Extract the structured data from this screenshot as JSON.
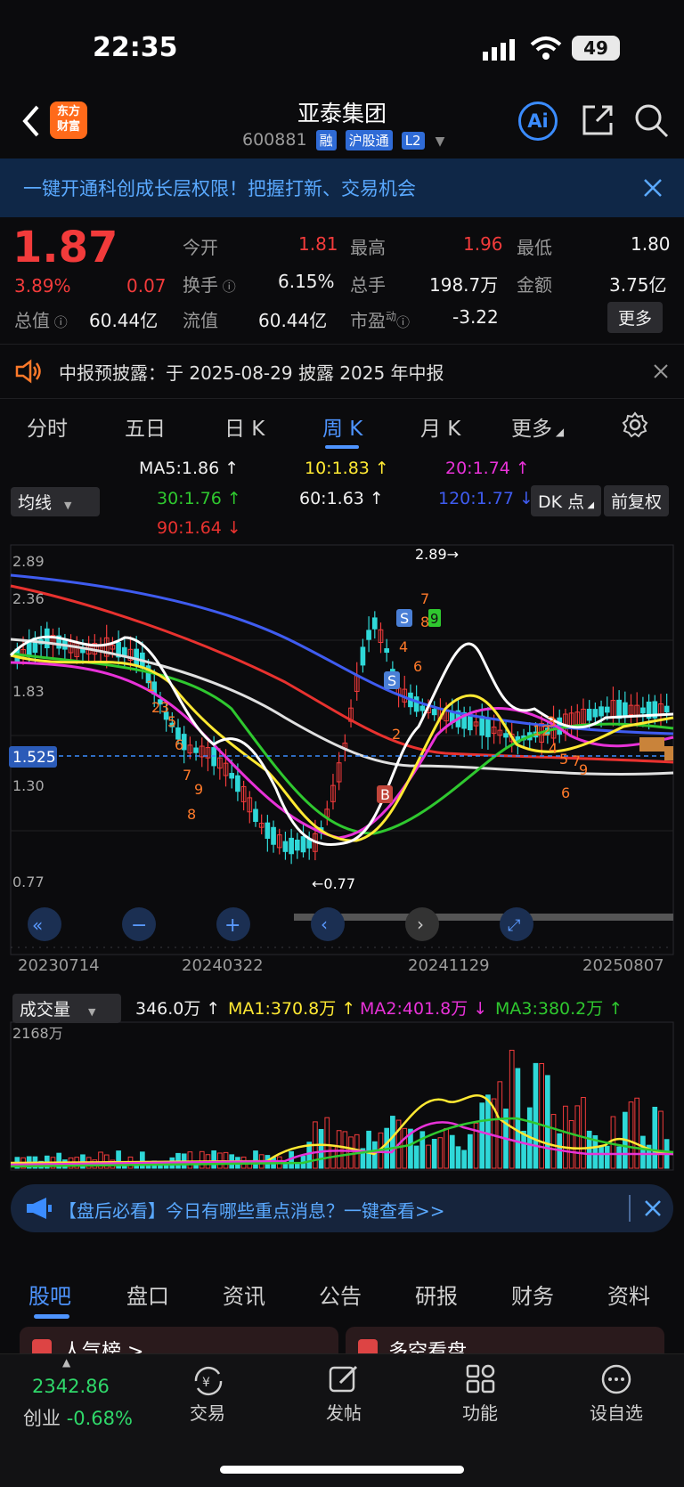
{
  "status": {
    "time": "22:35",
    "battery": "49"
  },
  "nav": {
    "back_icon": "chevron-left-icon",
    "logo_line1": "东方",
    "logo_line2": "财富",
    "title": "亚泰集团",
    "code": "600881",
    "tag1": "融",
    "tag2": "沪股通",
    "tag3": "L2",
    "ai_label": "Ai"
  },
  "banner": {
    "text": "一键开通科创成长层权限！把握打新、交易机会"
  },
  "quote": {
    "price": "1.87",
    "pct": "3.89%",
    "chg": "0.07",
    "open_label": "今开",
    "open": "1.81",
    "high_label": "最高",
    "high": "1.96",
    "low_label": "最低",
    "low": "1.80",
    "turnover_label": "换手",
    "turnover": "6.15%",
    "volume_label": "总手",
    "volume": "198.7万",
    "amount_label": "金额",
    "amount": "3.75亿",
    "mktcap_label": "总值",
    "mktcap": "60.44亿",
    "float_label": "流值",
    "float": "60.44亿",
    "pe_label": "市盈",
    "pe_sup": "动",
    "pe": "-3.22",
    "more": "更多"
  },
  "notice": {
    "text": "中报预披露：于 2025-08-29 披露 2025 年中报"
  },
  "period_tabs": [
    "分时",
    "五日",
    "日 K",
    "周 K",
    "月 K",
    "更多"
  ],
  "ma_legend": {
    "ma5": "MA5:1.86 ↑",
    "ma10": "10:1.83 ↑",
    "ma20": "20:1.74 ↑",
    "ma30": "30:1.76 ↑",
    "ma60": "60:1.63 ↑",
    "ma120": "120:1.77 ↓",
    "ma90": "90:1.64 ↓",
    "select": "均线",
    "dk": "DK 点",
    "fq": "前复权"
  },
  "chart_labels": {
    "y_top": "2.89",
    "y_2": "2.36",
    "y_3": "1.83",
    "y_4": "1.30",
    "y_bottom": "0.77",
    "current": "1.525",
    "max_mark": "2.89→",
    "min_mark": "←0.77",
    "dates": [
      "20230714",
      "20240322",
      "20241129",
      "20250807"
    ]
  },
  "volume": {
    "select": "成交量",
    "current": "346.0万 ↑",
    "ma1": "MA1:370.8万 ↑",
    "ma2": "MA2:401.8万 ↓",
    "ma3": "MA3:380.2万 ↑",
    "y_top": "2168万"
  },
  "news": {
    "text": "【盘后必看】今日有哪些重点消息？一键查看>>"
  },
  "bottom_tabs": [
    "股吧",
    "盘口",
    "资讯",
    "公告",
    "研报",
    "财务",
    "资料"
  ],
  "cards": {
    "left": "人气榜 >",
    "right": "多空看盘"
  },
  "tabbar": {
    "index_value": "2342.86",
    "index_name": "创业",
    "index_pct": "-0.68%",
    "items": [
      "交易",
      "发帖",
      "功能",
      "设自选"
    ]
  },
  "colors": {
    "up": "#f23b3b",
    "down": "#2fd8d8",
    "accent": "#4e94ff"
  }
}
